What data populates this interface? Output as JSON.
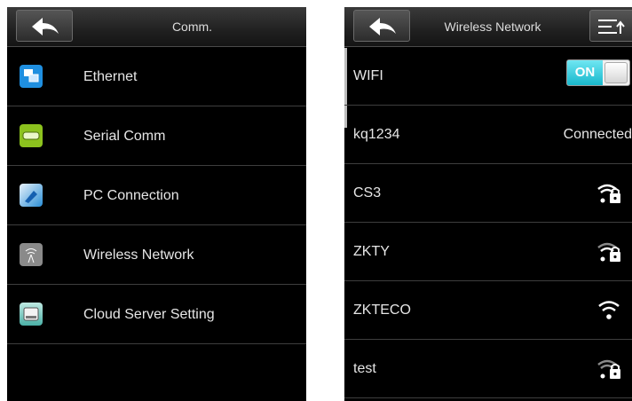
{
  "left": {
    "title": "Comm.",
    "items": [
      {
        "label": "Ethernet",
        "icon": "ethernet-icon",
        "color": "#1f8fe0"
      },
      {
        "label": "Serial Comm",
        "icon": "serial-comm-icon",
        "color": "#8cc21e"
      },
      {
        "label": "PC Connection",
        "icon": "pc-connection-icon",
        "color": "#2b8fd6"
      },
      {
        "label": "Wireless Network",
        "icon": "wireless-network-icon",
        "color": "#8a8a8a"
      },
      {
        "label": "Cloud Server Setting",
        "icon": "cloud-server-icon",
        "color": "#4bb0a6"
      }
    ]
  },
  "right": {
    "title": "Wireless Network",
    "wifi_label": "WIFI",
    "toggle_state": "ON",
    "networks": [
      {
        "ssid": "kq1234",
        "status": "Connected"
      },
      {
        "ssid": "CS3",
        "icon": "wifi-locked-icon"
      },
      {
        "ssid": "ZKTY",
        "icon": "wifi-locked-icon"
      },
      {
        "ssid": "ZKTECO",
        "icon": "wifi-icon"
      },
      {
        "ssid": "test",
        "icon": "wifi-locked-icon"
      }
    ]
  },
  "colors": {
    "background": "#000000",
    "accent": "#19b8cc",
    "text": "#e6e6e6"
  }
}
